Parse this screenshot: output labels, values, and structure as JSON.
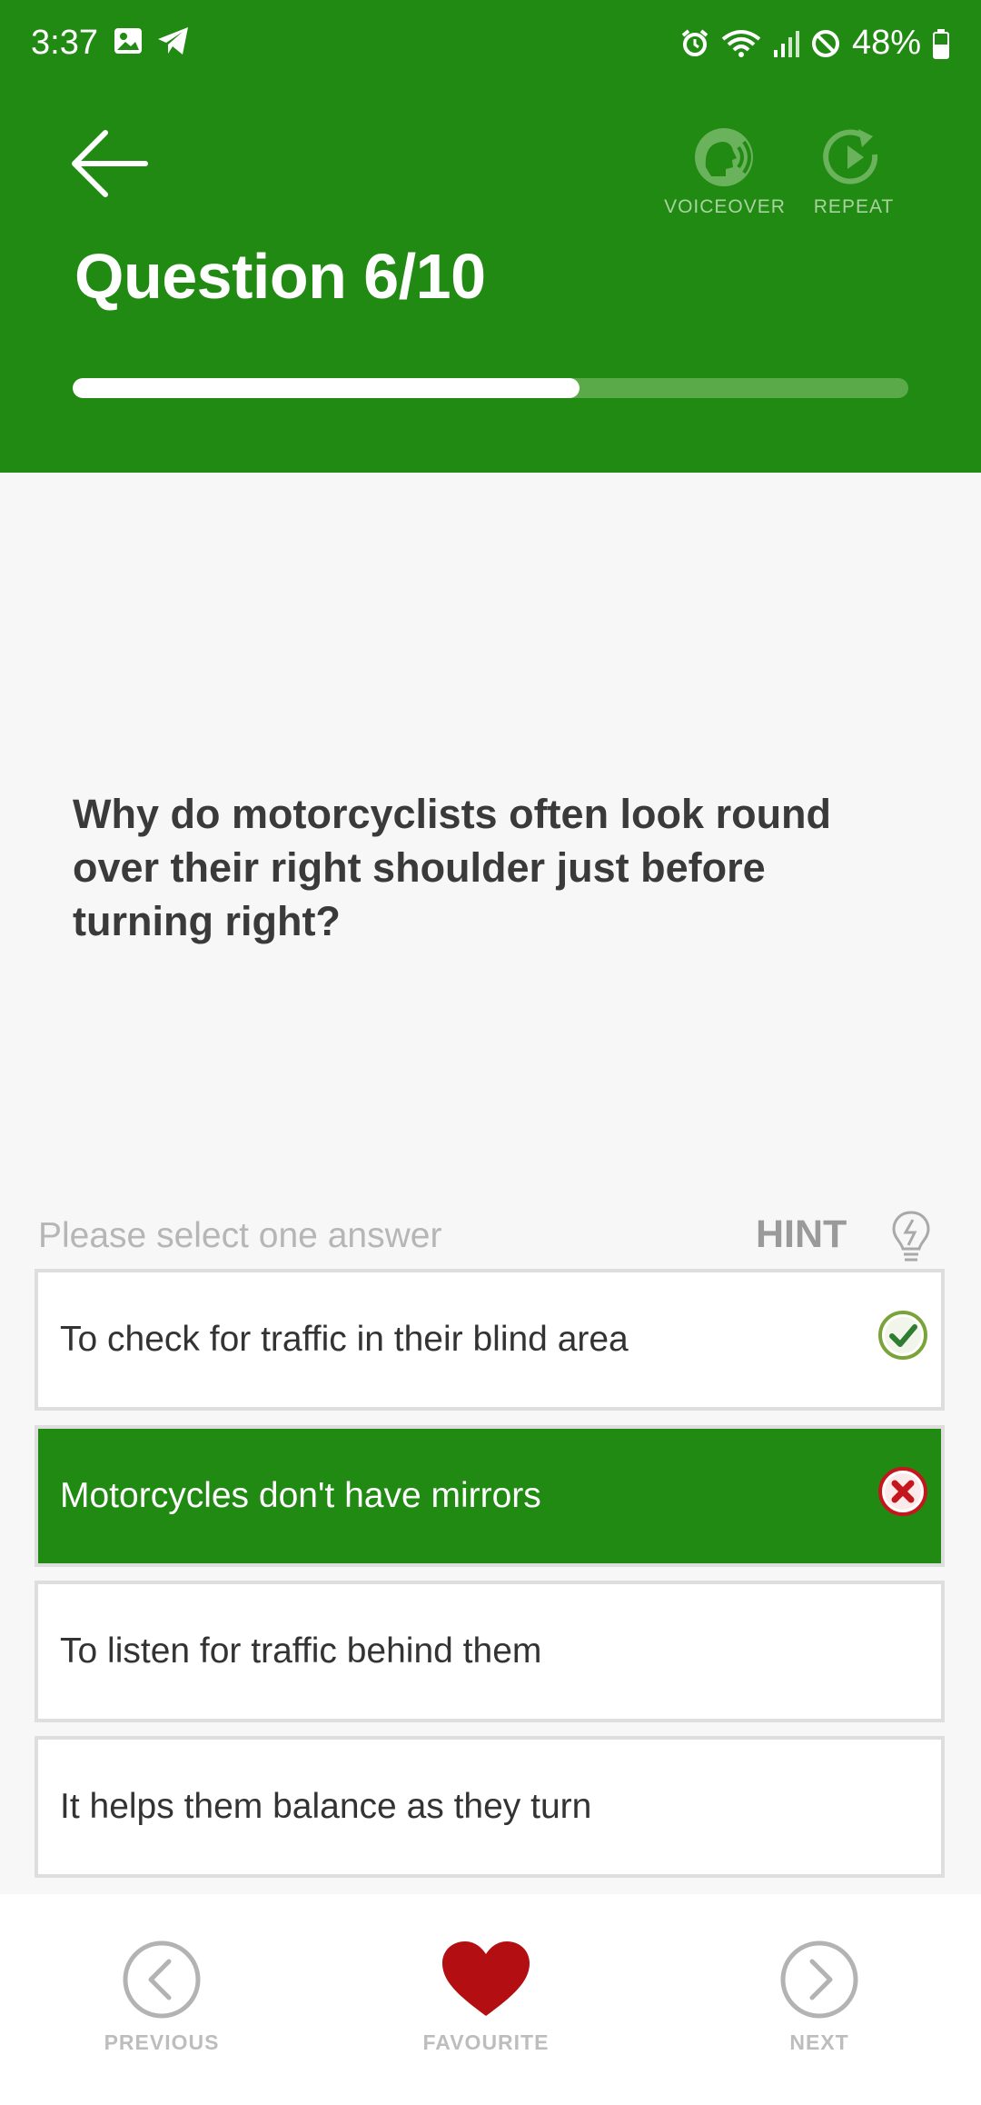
{
  "status": {
    "time": "3:37",
    "battery": "48%"
  },
  "header": {
    "title": "Question 6/10",
    "voiceover_label": "VOICEOVER",
    "repeat_label": "REPEAT",
    "progress": 0.606,
    "color": "#218a13"
  },
  "question": {
    "text": "Why do motorcyclists often look round over their right shoulder just before turning right?"
  },
  "answers_section": {
    "prompt": "Please select one answer",
    "hint_label": "HINT"
  },
  "answers": [
    {
      "text": "To check for traffic in their blind area",
      "state": "correct"
    },
    {
      "text": "Motorcycles don't have mirrors",
      "state": "selected-wrong"
    },
    {
      "text": "To listen for traffic behind them",
      "state": "none"
    },
    {
      "text": "It helps them balance as they turn",
      "state": "none"
    }
  ],
  "footer": {
    "previous_label": "PREVIOUS",
    "favourite_label": "FAVOURITE",
    "next_label": "NEXT",
    "favourite_color": "#b30f12"
  }
}
